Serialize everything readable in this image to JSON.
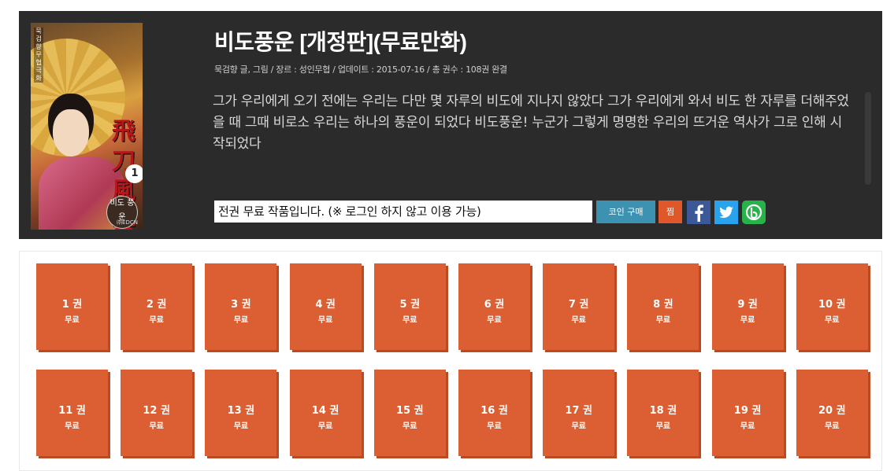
{
  "book": {
    "title": "비도풍운 [개정판](무료만화)",
    "meta": "묵검향 글, 그림 / 장르 : 성인무협 / 업데이트 : 2015-07-16 / 총 권수 : 108권 완결",
    "description": "그가 우리에게 오기 전에는 우리는 다만 몇 자루의 비도에 지나지 않았다 그가 우리에게 와서 비도 한 자루를 더해주었을 때 그때 비로소 우리는 하나의 풍운이 되었다 비도풍운! 누군가 그렇게 명명한 우리의 뜨거운 역사가 그로 인해 시작되었다",
    "notice": "전권 무료 작품입니다. (※ 로그인 하지 않고 이용 가능)"
  },
  "cover": {
    "top_text": "묵검향 무협극화",
    "calligraphy": "飛刀風雲",
    "volume_badge": "1",
    "logo_text": "비도 풍운",
    "publisher": "㈜EDCN"
  },
  "actions": {
    "coin_label": "코인 구매",
    "zzim_label": "찜",
    "facebook_icon": "facebook-icon",
    "twitter_icon": "twitter-icon",
    "band_icon": "band-icon"
  },
  "colors": {
    "header_bg": "#2b2b2b",
    "volume_bg": "#dc5f33",
    "coin_btn": "#3d91b1",
    "zzim_btn": "#e0572a"
  },
  "volumes": [
    {
      "label": "1 권",
      "price": "무료"
    },
    {
      "label": "2 권",
      "price": "무료"
    },
    {
      "label": "3 권",
      "price": "무료"
    },
    {
      "label": "4 권",
      "price": "무료"
    },
    {
      "label": "5 권",
      "price": "무료"
    },
    {
      "label": "6 권",
      "price": "무료"
    },
    {
      "label": "7 권",
      "price": "무료"
    },
    {
      "label": "8 권",
      "price": "무료"
    },
    {
      "label": "9 권",
      "price": "무료"
    },
    {
      "label": "10 권",
      "price": "무료"
    },
    {
      "label": "11 권",
      "price": "무료"
    },
    {
      "label": "12 권",
      "price": "무료"
    },
    {
      "label": "13 권",
      "price": "무료"
    },
    {
      "label": "14 권",
      "price": "무료"
    },
    {
      "label": "15 권",
      "price": "무료"
    },
    {
      "label": "16 권",
      "price": "무료"
    },
    {
      "label": "17 권",
      "price": "무료"
    },
    {
      "label": "18 권",
      "price": "무료"
    },
    {
      "label": "19 권",
      "price": "무료"
    },
    {
      "label": "20 권",
      "price": "무료"
    }
  ]
}
